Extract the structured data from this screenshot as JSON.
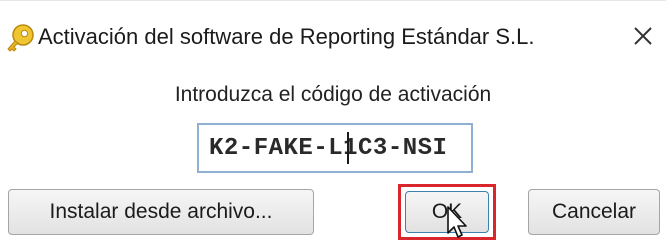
{
  "dialog": {
    "title": "Activación del software de Reporting Estándar S.L.",
    "prompt": "Introduzca el código de activación",
    "activation_code": "K2-FAKE-L1C3-NSI",
    "buttons": {
      "install_from_file": "Instalar desde archivo...",
      "ok": "OK",
      "cancel": "Cancelar"
    }
  },
  "icons": {
    "app": "key-icon",
    "close": "close-icon",
    "cursor": "mouse-pointer-icon"
  },
  "colors": {
    "highlight_frame": "#d9262c",
    "input_border": "#8fb0d3",
    "icon_gold": "#e6b422"
  }
}
